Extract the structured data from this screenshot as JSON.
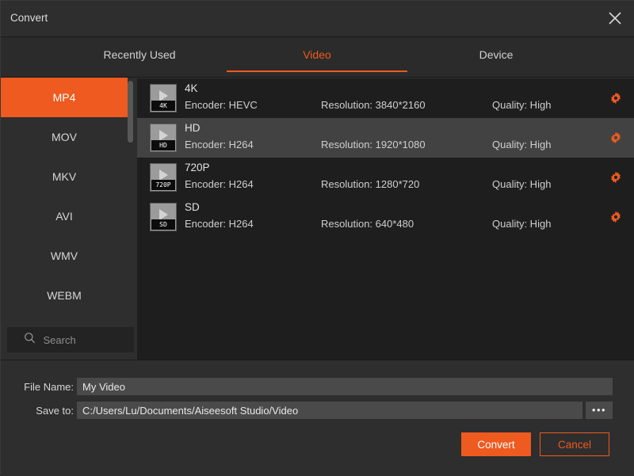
{
  "window": {
    "title": "Convert",
    "close_icon": "close-icon"
  },
  "tabs": [
    {
      "label": "Recently Used",
      "active": false
    },
    {
      "label": "Video",
      "active": true
    },
    {
      "label": "Device",
      "active": false
    }
  ],
  "sidebar": {
    "items": [
      {
        "label": "MP4",
        "active": true
      },
      {
        "label": "MOV",
        "active": false
      },
      {
        "label": "MKV",
        "active": false
      },
      {
        "label": "AVI",
        "active": false
      },
      {
        "label": "WMV",
        "active": false
      },
      {
        "label": "WEBM",
        "active": false
      }
    ],
    "search": {
      "placeholder": "Search",
      "value": "",
      "icon": "search-icon"
    }
  },
  "presets": [
    {
      "name": "4K",
      "badge": "4K",
      "encoder": "Encoder: HEVC",
      "resolution": "Resolution: 3840*2160",
      "quality": "Quality: High",
      "selected": false,
      "gear_icon": "gear-icon"
    },
    {
      "name": "HD",
      "badge": "HD",
      "encoder": "Encoder: H264",
      "resolution": "Resolution: 1920*1080",
      "quality": "Quality: High",
      "selected": true,
      "gear_icon": "gear-icon"
    },
    {
      "name": "720P",
      "badge": "720P",
      "encoder": "Encoder: H264",
      "resolution": "Resolution: 1280*720",
      "quality": "Quality: High",
      "selected": false,
      "gear_icon": "gear-icon"
    },
    {
      "name": "SD",
      "badge": "SD",
      "encoder": "Encoder: H264",
      "resolution": "Resolution: 640*480",
      "quality": "Quality: High",
      "selected": false,
      "gear_icon": "gear-icon"
    }
  ],
  "form": {
    "filename_label": "File Name:",
    "filename_value": "My Video",
    "saveto_label": "Save to:",
    "saveto_value": "C:/Users/Lu/Documents/Aiseesoft Studio/Video",
    "browse_label": "•••"
  },
  "actions": {
    "convert_label": "Convert",
    "cancel_label": "Cancel"
  },
  "colors": {
    "accent": "#ee5a1f",
    "window_bg": "#1e1e1e",
    "panel_bg": "#2e2e2e",
    "row_selected": "#424242",
    "field_bg": "#4a4a4a"
  }
}
